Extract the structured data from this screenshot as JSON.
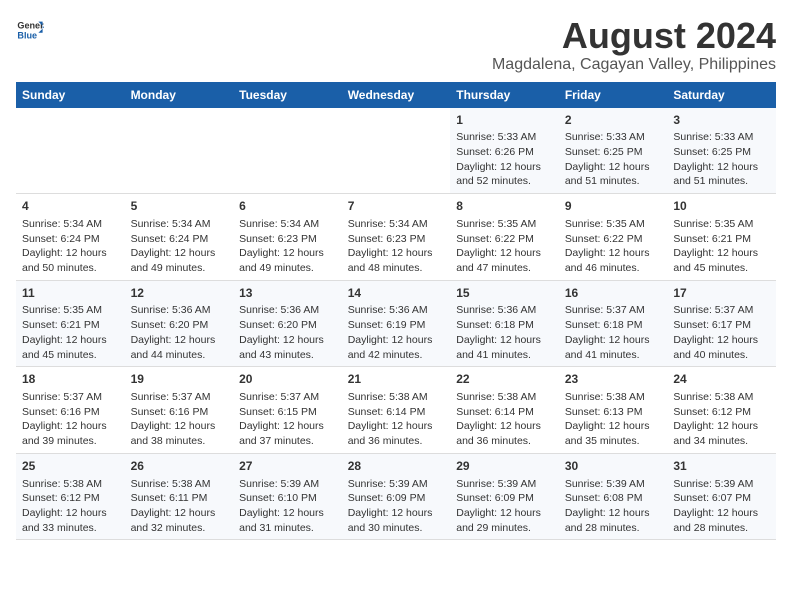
{
  "logo": {
    "line1": "General",
    "line2": "Blue"
  },
  "title": "August 2024",
  "subtitle": "Magdalena, Cagayan Valley, Philippines",
  "headers": [
    "Sunday",
    "Monday",
    "Tuesday",
    "Wednesday",
    "Thursday",
    "Friday",
    "Saturday"
  ],
  "weeks": [
    [
      {
        "day": "",
        "sunrise": "",
        "sunset": "",
        "daylight": ""
      },
      {
        "day": "",
        "sunrise": "",
        "sunset": "",
        "daylight": ""
      },
      {
        "day": "",
        "sunrise": "",
        "sunset": "",
        "daylight": ""
      },
      {
        "day": "",
        "sunrise": "",
        "sunset": "",
        "daylight": ""
      },
      {
        "day": "1",
        "sunrise": "Sunrise: 5:33 AM",
        "sunset": "Sunset: 6:26 PM",
        "daylight": "Daylight: 12 hours and 52 minutes."
      },
      {
        "day": "2",
        "sunrise": "Sunrise: 5:33 AM",
        "sunset": "Sunset: 6:25 PM",
        "daylight": "Daylight: 12 hours and 51 minutes."
      },
      {
        "day": "3",
        "sunrise": "Sunrise: 5:33 AM",
        "sunset": "Sunset: 6:25 PM",
        "daylight": "Daylight: 12 hours and 51 minutes."
      }
    ],
    [
      {
        "day": "4",
        "sunrise": "Sunrise: 5:34 AM",
        "sunset": "Sunset: 6:24 PM",
        "daylight": "Daylight: 12 hours and 50 minutes."
      },
      {
        "day": "5",
        "sunrise": "Sunrise: 5:34 AM",
        "sunset": "Sunset: 6:24 PM",
        "daylight": "Daylight: 12 hours and 49 minutes."
      },
      {
        "day": "6",
        "sunrise": "Sunrise: 5:34 AM",
        "sunset": "Sunset: 6:23 PM",
        "daylight": "Daylight: 12 hours and 49 minutes."
      },
      {
        "day": "7",
        "sunrise": "Sunrise: 5:34 AM",
        "sunset": "Sunset: 6:23 PM",
        "daylight": "Daylight: 12 hours and 48 minutes."
      },
      {
        "day": "8",
        "sunrise": "Sunrise: 5:35 AM",
        "sunset": "Sunset: 6:22 PM",
        "daylight": "Daylight: 12 hours and 47 minutes."
      },
      {
        "day": "9",
        "sunrise": "Sunrise: 5:35 AM",
        "sunset": "Sunset: 6:22 PM",
        "daylight": "Daylight: 12 hours and 46 minutes."
      },
      {
        "day": "10",
        "sunrise": "Sunrise: 5:35 AM",
        "sunset": "Sunset: 6:21 PM",
        "daylight": "Daylight: 12 hours and 45 minutes."
      }
    ],
    [
      {
        "day": "11",
        "sunrise": "Sunrise: 5:35 AM",
        "sunset": "Sunset: 6:21 PM",
        "daylight": "Daylight: 12 hours and 45 minutes."
      },
      {
        "day": "12",
        "sunrise": "Sunrise: 5:36 AM",
        "sunset": "Sunset: 6:20 PM",
        "daylight": "Daylight: 12 hours and 44 minutes."
      },
      {
        "day": "13",
        "sunrise": "Sunrise: 5:36 AM",
        "sunset": "Sunset: 6:20 PM",
        "daylight": "Daylight: 12 hours and 43 minutes."
      },
      {
        "day": "14",
        "sunrise": "Sunrise: 5:36 AM",
        "sunset": "Sunset: 6:19 PM",
        "daylight": "Daylight: 12 hours and 42 minutes."
      },
      {
        "day": "15",
        "sunrise": "Sunrise: 5:36 AM",
        "sunset": "Sunset: 6:18 PM",
        "daylight": "Daylight: 12 hours and 41 minutes."
      },
      {
        "day": "16",
        "sunrise": "Sunrise: 5:37 AM",
        "sunset": "Sunset: 6:18 PM",
        "daylight": "Daylight: 12 hours and 41 minutes."
      },
      {
        "day": "17",
        "sunrise": "Sunrise: 5:37 AM",
        "sunset": "Sunset: 6:17 PM",
        "daylight": "Daylight: 12 hours and 40 minutes."
      }
    ],
    [
      {
        "day": "18",
        "sunrise": "Sunrise: 5:37 AM",
        "sunset": "Sunset: 6:16 PM",
        "daylight": "Daylight: 12 hours and 39 minutes."
      },
      {
        "day": "19",
        "sunrise": "Sunrise: 5:37 AM",
        "sunset": "Sunset: 6:16 PM",
        "daylight": "Daylight: 12 hours and 38 minutes."
      },
      {
        "day": "20",
        "sunrise": "Sunrise: 5:37 AM",
        "sunset": "Sunset: 6:15 PM",
        "daylight": "Daylight: 12 hours and 37 minutes."
      },
      {
        "day": "21",
        "sunrise": "Sunrise: 5:38 AM",
        "sunset": "Sunset: 6:14 PM",
        "daylight": "Daylight: 12 hours and 36 minutes."
      },
      {
        "day": "22",
        "sunrise": "Sunrise: 5:38 AM",
        "sunset": "Sunset: 6:14 PM",
        "daylight": "Daylight: 12 hours and 36 minutes."
      },
      {
        "day": "23",
        "sunrise": "Sunrise: 5:38 AM",
        "sunset": "Sunset: 6:13 PM",
        "daylight": "Daylight: 12 hours and 35 minutes."
      },
      {
        "day": "24",
        "sunrise": "Sunrise: 5:38 AM",
        "sunset": "Sunset: 6:12 PM",
        "daylight": "Daylight: 12 hours and 34 minutes."
      }
    ],
    [
      {
        "day": "25",
        "sunrise": "Sunrise: 5:38 AM",
        "sunset": "Sunset: 6:12 PM",
        "daylight": "Daylight: 12 hours and 33 minutes."
      },
      {
        "day": "26",
        "sunrise": "Sunrise: 5:38 AM",
        "sunset": "Sunset: 6:11 PM",
        "daylight": "Daylight: 12 hours and 32 minutes."
      },
      {
        "day": "27",
        "sunrise": "Sunrise: 5:39 AM",
        "sunset": "Sunset: 6:10 PM",
        "daylight": "Daylight: 12 hours and 31 minutes."
      },
      {
        "day": "28",
        "sunrise": "Sunrise: 5:39 AM",
        "sunset": "Sunset: 6:09 PM",
        "daylight": "Daylight: 12 hours and 30 minutes."
      },
      {
        "day": "29",
        "sunrise": "Sunrise: 5:39 AM",
        "sunset": "Sunset: 6:09 PM",
        "daylight": "Daylight: 12 hours and 29 minutes."
      },
      {
        "day": "30",
        "sunrise": "Sunrise: 5:39 AM",
        "sunset": "Sunset: 6:08 PM",
        "daylight": "Daylight: 12 hours and 28 minutes."
      },
      {
        "day": "31",
        "sunrise": "Sunrise: 5:39 AM",
        "sunset": "Sunset: 6:07 PM",
        "daylight": "Daylight: 12 hours and 28 minutes."
      }
    ]
  ]
}
